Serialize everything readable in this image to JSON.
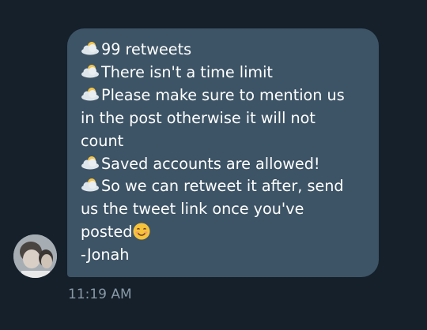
{
  "message": {
    "lines": [
      "99 retweets",
      "There isn't a time limit",
      "Please make sure to mention us",
      "in the post otherwise it will not",
      "count",
      "Saved accounts are allowed!",
      "So we can retweet it after, send",
      "us the tweet link once you've",
      "posted",
      "-Jonah"
    ],
    "bullet_icon": "sun-behind-cloud-icon",
    "end_emoji": "smiling-face-icon",
    "timestamp": "11:19 AM"
  },
  "colors": {
    "background": "#15202b",
    "bubble": "#3d5466",
    "text": "#ffffff",
    "timestamp": "#8899a6"
  }
}
